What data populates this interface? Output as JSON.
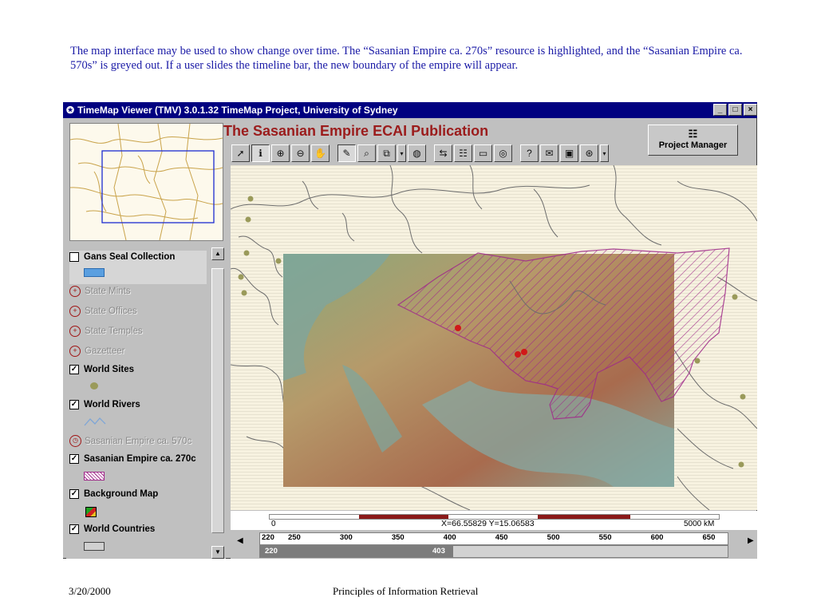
{
  "caption": "The map interface may be used to show change over time. The “Sasanian Empire ca. 270s” resource is highlighted, and the “Sasanian Empire ca. 570s” is greyed out.  If a user slides the timeline bar, the new boundary of the empire will appear.",
  "window": {
    "title": "TimeMap Viewer (TMV) 3.0.1.32 TimeMap Project, University of Sydney",
    "min_label": "_",
    "max_label": "□",
    "close_label": "×"
  },
  "publication_title": "The Sasanian Empire ECAI Publication",
  "project_manager": {
    "label": "Project Manager",
    "icon": "project-manager-icon"
  },
  "toolbar": [
    {
      "name": "select-arrow-icon",
      "glyph": "➚",
      "active": false
    },
    {
      "name": "info-icon",
      "glyph": "ℹ",
      "active": true
    },
    {
      "name": "zoom-in-icon",
      "glyph": "⊕",
      "active": false
    },
    {
      "name": "zoom-out-icon",
      "glyph": "⊖",
      "active": false
    },
    {
      "name": "pan-hand-icon",
      "glyph": "✋",
      "active": false
    },
    {
      "name": "ruler-icon",
      "glyph": "✎",
      "active": true
    },
    {
      "name": "find-icon",
      "glyph": "⌕",
      "active": false
    },
    {
      "name": "copy-icon",
      "glyph": "⧉",
      "active": false
    },
    {
      "name": "dropdown-icon",
      "glyph": "▾",
      "active": false
    },
    {
      "name": "globe-search-icon",
      "glyph": "◍",
      "active": false
    },
    {
      "name": "arrange-icon",
      "glyph": "⇆",
      "active": false
    },
    {
      "name": "legend-icon",
      "glyph": "☷",
      "active": false
    },
    {
      "name": "window-icon",
      "glyph": "▭",
      "active": false
    },
    {
      "name": "target-icon",
      "glyph": "◎",
      "active": false
    },
    {
      "name": "help-icon",
      "glyph": "?",
      "active": false
    },
    {
      "name": "open-folder-icon",
      "glyph": "✉",
      "active": false
    },
    {
      "name": "save-icon",
      "glyph": "▣",
      "active": false
    },
    {
      "name": "export-icon",
      "glyph": "⊛",
      "active": false
    },
    {
      "name": "dropdown-2-icon",
      "glyph": "▾",
      "active": false
    }
  ],
  "layers": [
    {
      "label": "Gans Seal Collection",
      "type": "checkbox",
      "checked": false,
      "greyed": false,
      "swatch": "blue-rect"
    },
    {
      "label": "State Mints",
      "type": "query",
      "greyed": true
    },
    {
      "label": "State Offices",
      "type": "query",
      "greyed": true
    },
    {
      "label": "State Temples",
      "type": "query",
      "greyed": true
    },
    {
      "label": "Gazetteer",
      "type": "query",
      "greyed": true
    },
    {
      "label": "World Sites",
      "type": "checkbox",
      "checked": true,
      "greyed": false,
      "swatch": "olive-dot"
    },
    {
      "label": "World Rivers",
      "type": "checkbox",
      "checked": true,
      "greyed": false,
      "swatch": "river-line"
    },
    {
      "label": "Sasanian Empire ca. 570c",
      "type": "clock",
      "greyed": true
    },
    {
      "label": "Sasanian Empire ca. 270c",
      "type": "checkbox",
      "checked": true,
      "greyed": false,
      "swatch": "hatch"
    },
    {
      "label": "Background Map",
      "type": "checkbox",
      "checked": true,
      "greyed": false,
      "swatch": "map-thumb"
    },
    {
      "label": "World Countries",
      "type": "checkbox",
      "checked": true,
      "greyed": false,
      "swatch": "grey-rect"
    }
  ],
  "scale": {
    "zero": "0",
    "coord": "X=66.55829  Y=15.06583",
    "end": "5000 kM"
  },
  "timeline": {
    "ticks": [
      "220",
      "250",
      "300",
      "350",
      "400",
      "450",
      "500",
      "550",
      "600",
      "650"
    ],
    "tick_values": [
      220,
      250,
      300,
      350,
      400,
      450,
      500,
      550,
      600,
      650
    ],
    "range_min": 220,
    "range_max": 665,
    "start_label": "220",
    "end_label": "403",
    "start": 220,
    "end": 403,
    "left_arrow": "◀",
    "right_arrow": "▶"
  },
  "footer": {
    "date": "3/20/2000",
    "title": "Principles of Information Retrieval"
  },
  "colors": {
    "title_red": "#9b1c1c",
    "caption_blue": "#1a1aa6",
    "hatch_purple": "#a02a8a",
    "titlebar": "#000080"
  }
}
